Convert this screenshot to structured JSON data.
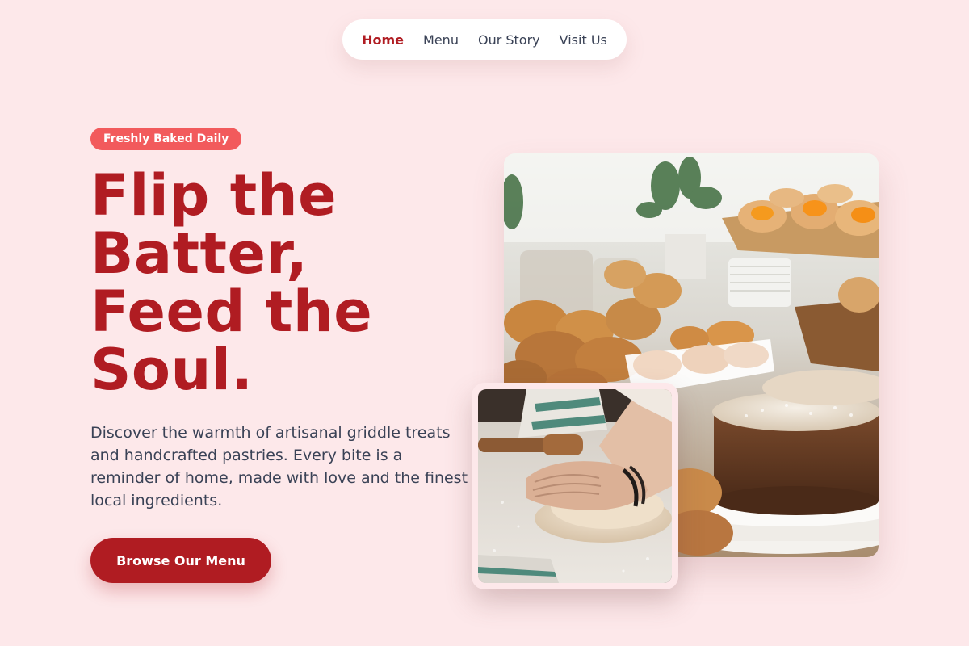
{
  "nav": {
    "items": [
      {
        "label": "Home",
        "active": true
      },
      {
        "label": "Menu",
        "active": false
      },
      {
        "label": "Our Story",
        "active": false
      },
      {
        "label": "Visit Us",
        "active": false
      }
    ]
  },
  "hero": {
    "badge": "Freshly Baked Daily",
    "headline": "Flip the Batter, Feed the Soul.",
    "description": "Discover the warmth of artisanal griddle treats and handcrafted pastries. Every bite is a reminder of home, made with love and the finest local ingredients.",
    "cta_label": "Browse Our Menu"
  },
  "images": {
    "main_alt": "pastry-display-photo",
    "inset_alt": "kneading-dough-photo"
  },
  "colors": {
    "background": "#fde8ea",
    "brand_red": "#b01c22",
    "badge_red": "#f25a5c",
    "text_dark": "#3a4256"
  }
}
